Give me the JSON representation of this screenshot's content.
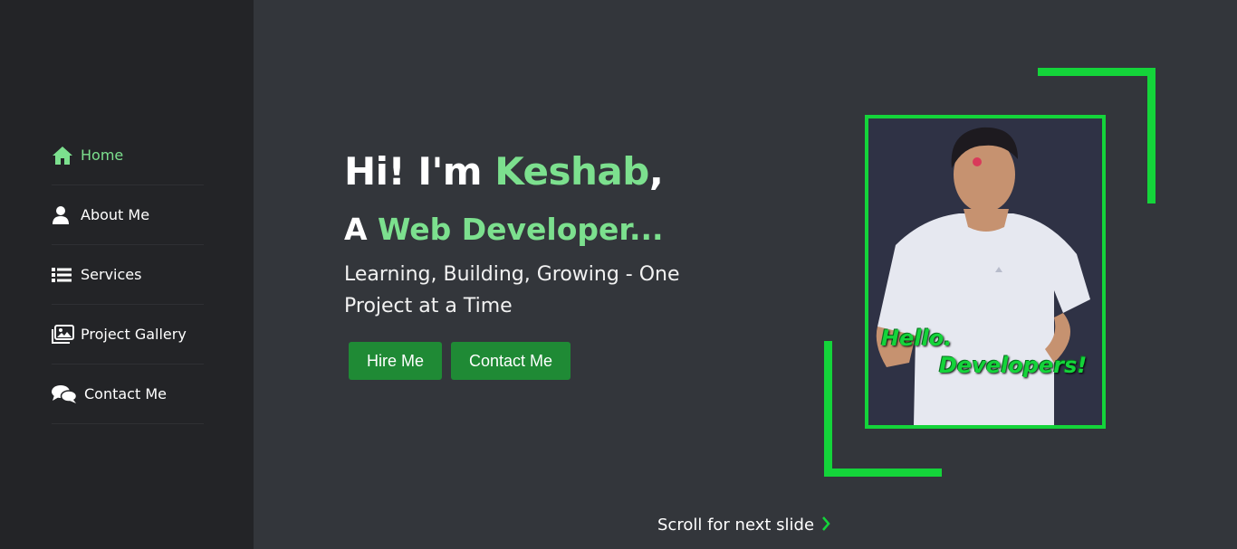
{
  "sidebar": {
    "items": [
      {
        "label": "Home",
        "icon": "home-icon",
        "active": true
      },
      {
        "label": "About Me",
        "icon": "user-icon"
      },
      {
        "label": "Services",
        "icon": "list-icon"
      },
      {
        "label": "Project Gallery",
        "icon": "images-icon"
      },
      {
        "label": "Contact Me",
        "icon": "comments-icon"
      }
    ]
  },
  "hero": {
    "greeting_prefix": "Hi! I'm ",
    "name": "Keshab",
    "greeting_suffix": ",",
    "role_prefix": "A ",
    "role": "Web Developer...",
    "tagline": "Learning, Building, Growing - One Project at a Time",
    "hire_label": "Hire Me",
    "contact_label": "Contact Me"
  },
  "photo": {
    "overlay_line1": "Hello.",
    "overlay_line2": "Developers!"
  },
  "scroll_hint": "Scroll for next slide",
  "colors": {
    "accent": "#7ce08e",
    "frame": "#14d43a",
    "button": "#1f8a35",
    "background": "#33363b",
    "sidebar": "#232427"
  }
}
